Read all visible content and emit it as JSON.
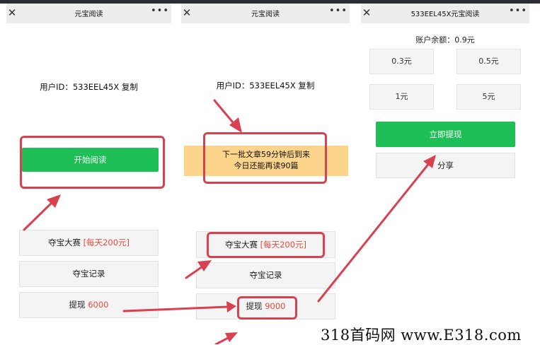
{
  "panel1": {
    "title": "元宝阅读",
    "close_icon": "close-icon",
    "more_icon": "more-icon",
    "user_id": "用户ID：533EEL45X 复制",
    "start_button": "开始阅读",
    "treasure_contest": "夺宝大赛",
    "treasure_contest_badge": "[每天200元]",
    "treasure_records": "夺宝记录",
    "withdraw_label": "提现",
    "withdraw_value": "6000"
  },
  "panel2": {
    "title": "元宝阅读",
    "user_id": "用户ID：533EEL45X 复制",
    "notice_line1": "下一批文章59分钟后到来",
    "notice_line2": "今日还能再读90篇",
    "treasure_contest": "夺宝大赛",
    "treasure_contest_badge": "[每天200元]",
    "treasure_records": "夺宝记录",
    "withdraw_label": "提现",
    "withdraw_value": "9000"
  },
  "panel3": {
    "title": "533EEL45X元宝阅读",
    "balance": "账户余额：0.9元",
    "amounts": [
      "0.3元",
      "0.5元",
      "1元",
      "5元"
    ],
    "withdraw_now": "立即提现",
    "share": "分享"
  },
  "watermark": "318首码网 www.E318.com",
  "colors": {
    "green": "#1fbf58",
    "annotation_red": "#d94150",
    "notice_yellow": "#fcd48b",
    "badge_red": "#e64b3c"
  }
}
